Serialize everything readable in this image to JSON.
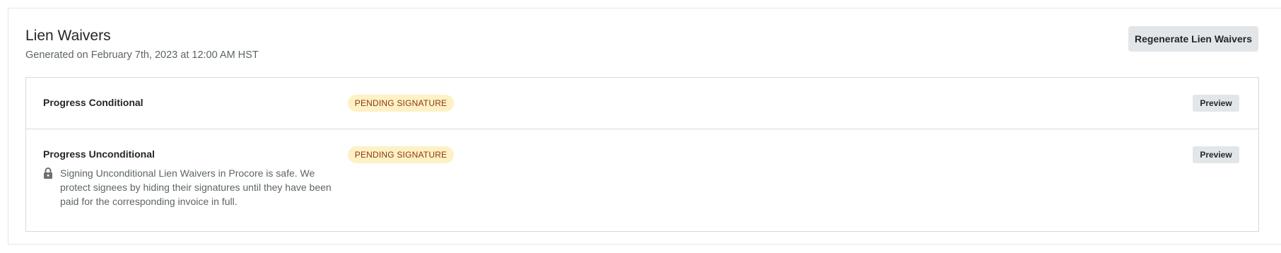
{
  "header": {
    "title": "Lien Waivers",
    "subtitle": "Generated on February 7th, 2023 at 12:00 AM HST",
    "regenerate_label": "Regenerate Lien Waivers"
  },
  "waivers": [
    {
      "name": "Progress Conditional",
      "status": "PENDING SIGNATURE",
      "preview_label": "Preview"
    },
    {
      "name": "Progress Unconditional",
      "status": "PENDING SIGNATURE",
      "preview_label": "Preview",
      "note": "Signing Unconditional Lien Waivers in Procore is safe. We protect signees by hiding their signatures until they have been paid for the corresponding invoice in full.",
      "note_icon": "lock-icon"
    }
  ],
  "colors": {
    "badge_bg": "#fdf1c5",
    "badge_text": "#8b3a0e",
    "button_bg": "#e3e6e8",
    "border": "#d6dadc"
  }
}
